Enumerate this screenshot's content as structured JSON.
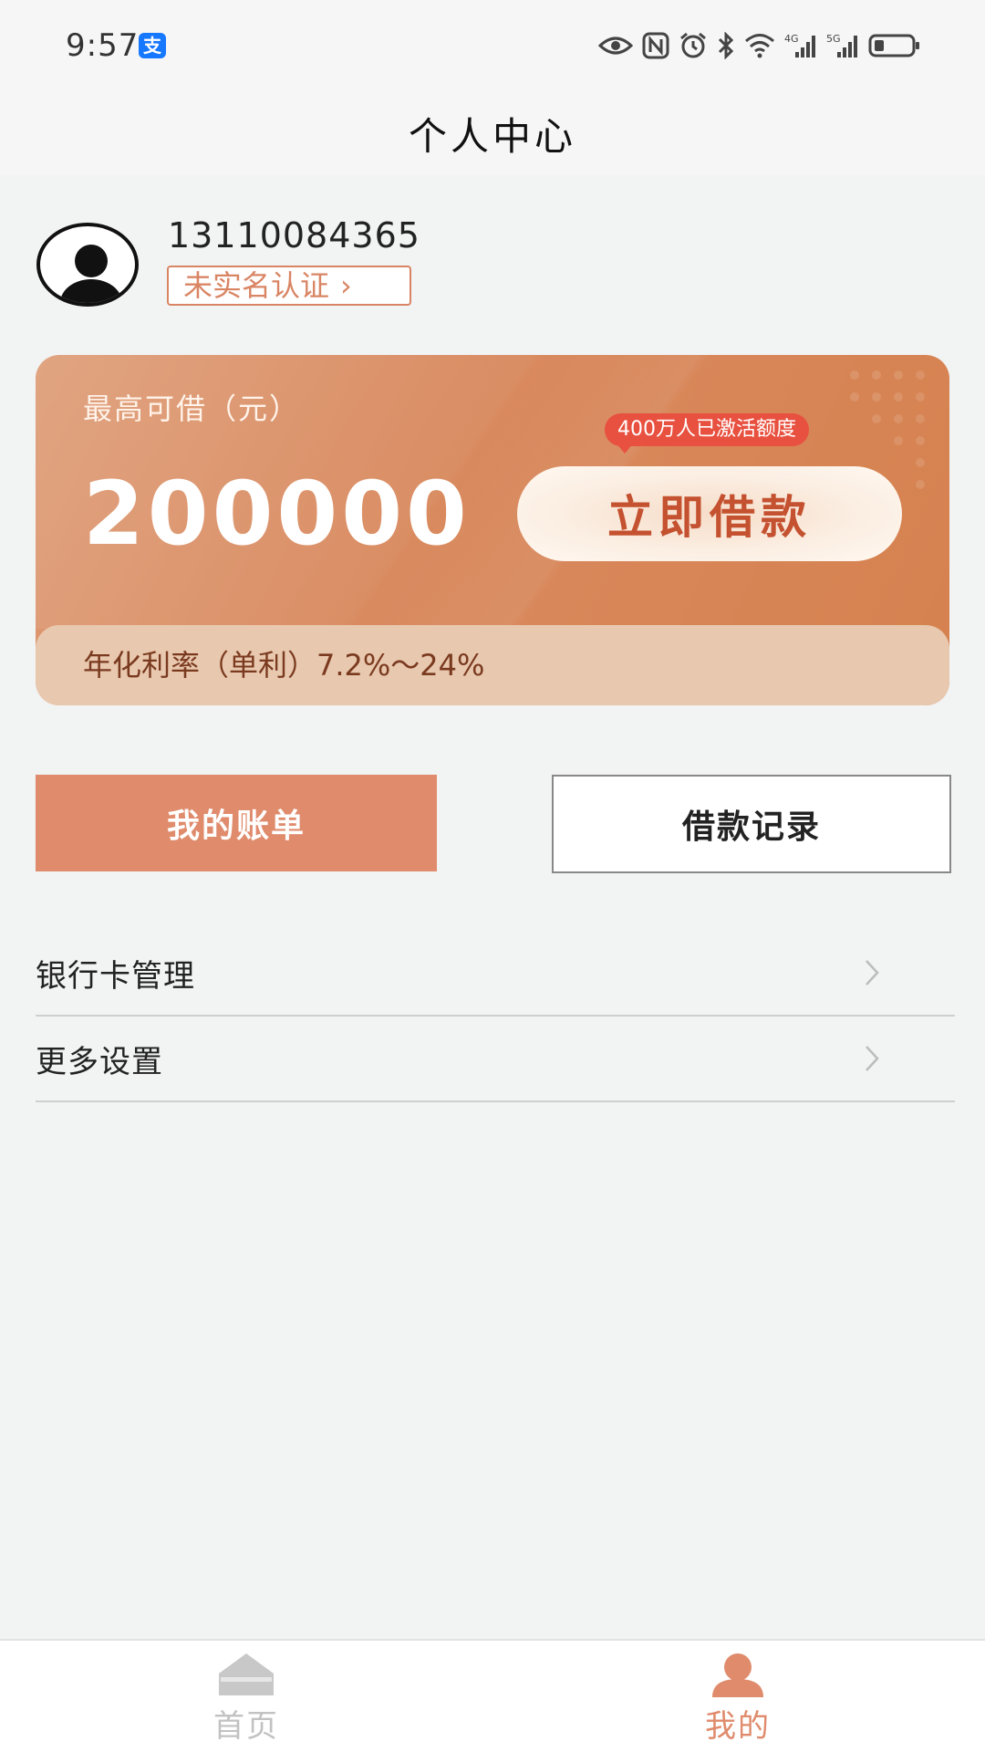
{
  "status_bar": {
    "time": "9:57",
    "app_badge": "支",
    "icons": [
      "eye-icon",
      "nfc-icon",
      "alarm-icon",
      "bluetooth-icon",
      "wifi-icon",
      "signal-4g-icon",
      "signal-5g-icon",
      "battery-icon"
    ],
    "network_1": "4G",
    "network_2": "5G"
  },
  "header": {
    "title": "个人中心"
  },
  "profile": {
    "phone": "13110084365",
    "verify_label": "未实名认证",
    "verify_chevron": "›"
  },
  "loan_card": {
    "label": "最高可借（元）",
    "amount": "200000",
    "badge": "400万人已激活额度",
    "borrow_button": "立即借款",
    "rate": "年化利率（单利）7.2%～24%"
  },
  "actions": {
    "bill_button": "我的账单",
    "record_button": "借款记录"
  },
  "menu": {
    "items": [
      {
        "label": "银行卡管理"
      },
      {
        "label": "更多设置"
      }
    ]
  },
  "tab_bar": {
    "home_label": "首页",
    "mine_label": "我的"
  },
  "colors": {
    "accent": "#df8b6c",
    "card_start": "#dd9a73",
    "card_end": "#d6814f",
    "badge": "#e8503f",
    "button_text": "#c4512f"
  }
}
